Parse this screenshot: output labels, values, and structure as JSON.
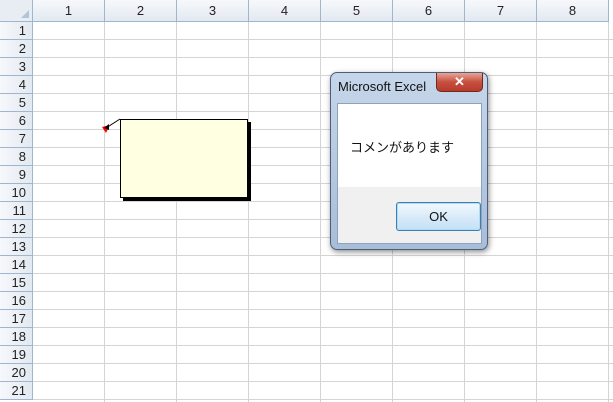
{
  "columns": [
    "1",
    "2",
    "3",
    "4",
    "5",
    "6",
    "7",
    "8"
  ],
  "rows": [
    "1",
    "2",
    "3",
    "4",
    "5",
    "6",
    "7",
    "8",
    "9",
    "10",
    "11",
    "12",
    "13",
    "14",
    "15",
    "16",
    "17",
    "18",
    "19",
    "20",
    "21"
  ],
  "comment": {
    "text": ""
  },
  "dialog": {
    "title": "Microsoft Excel",
    "close_glyph": "✕",
    "message": "コメンがあります",
    "ok_label": "OK"
  },
  "colors": {
    "comment_fill": "#ffffe1",
    "indicator": "#ff0000",
    "header_border": "#9eb6ce"
  }
}
